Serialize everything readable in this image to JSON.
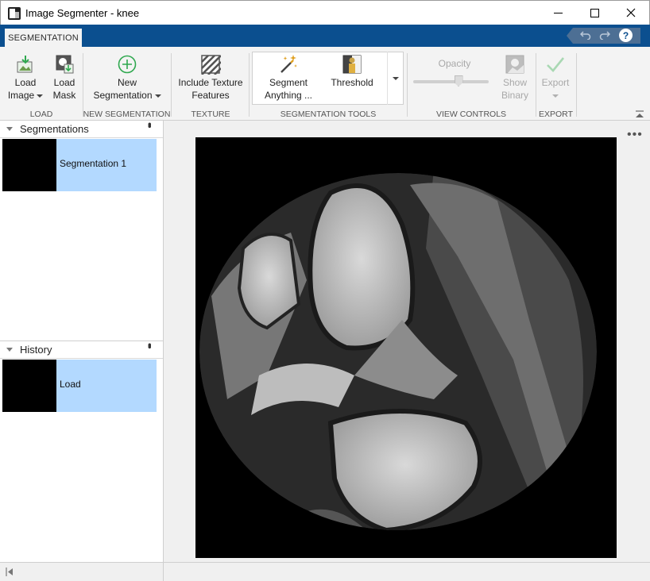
{
  "window": {
    "title": "Image Segmenter - knee",
    "controls": [
      "minimize",
      "maximize",
      "close"
    ]
  },
  "ribbon": {
    "active_tab": "SEGMENTATION",
    "quick_access": [
      "undo-icon",
      "redo-icon",
      "help-icon"
    ],
    "groups": {
      "load": {
        "label": "LOAD",
        "load_image": [
          "Load",
          "Image"
        ],
        "load_mask": [
          "Load",
          "Mask"
        ]
      },
      "new_segmentation": {
        "label": "NEW SEGMENTATION",
        "new_segmentation": [
          "New",
          "Segmentation"
        ]
      },
      "texture": {
        "label": "TEXTURE",
        "include_texture": [
          "Include Texture",
          "Features"
        ]
      },
      "segmentation_tools": {
        "label": "SEGMENTATION TOOLS",
        "segment_anything": [
          "Segment",
          "Anything ..."
        ],
        "threshold": "Threshold"
      },
      "view_controls": {
        "label": "VIEW CONTROLS",
        "opacity_label": "Opacity",
        "opacity_value": 0.6,
        "show_binary": [
          "Show",
          "Binary"
        ]
      },
      "export": {
        "label": "EXPORT",
        "export": "Export"
      }
    }
  },
  "segmentations_panel": {
    "title": "Segmentations",
    "items": [
      {
        "label": "Segmentation 1",
        "selected": true
      }
    ]
  },
  "history_panel": {
    "title": "History",
    "items": [
      {
        "label": "Load",
        "selected": true
      }
    ]
  },
  "colors": {
    "ribbon_blue": "#0b4f8f",
    "selection": "#b3d9ff",
    "new_seg_green": "#2fa84f"
  }
}
